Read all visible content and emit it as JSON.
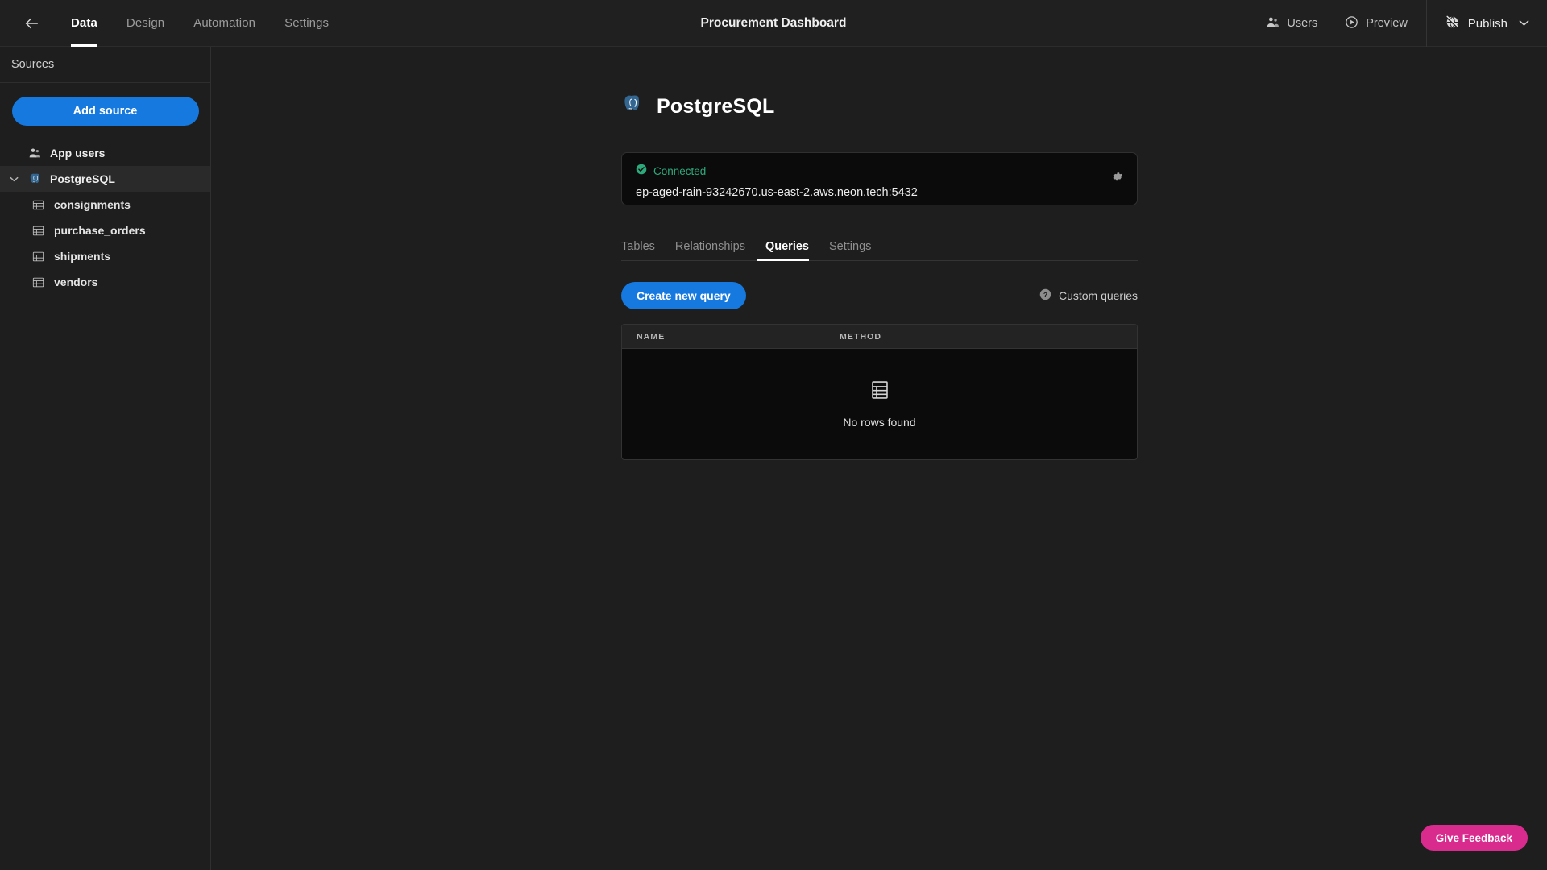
{
  "topbar": {
    "back_icon": "arrow-left-icon",
    "nav_tabs": [
      {
        "label": "Data",
        "active": true
      },
      {
        "label": "Design",
        "active": false
      },
      {
        "label": "Automation",
        "active": false
      },
      {
        "label": "Settings",
        "active": false
      }
    ],
    "app_title": "Procurement Dashboard",
    "users_label": "Users",
    "users_icon": "users-icon",
    "preview_label": "Preview",
    "preview_icon": "play-circle-icon",
    "publish_label": "Publish",
    "publish_icon": "globe-slash-icon",
    "publish_caret": "chevron-down-icon"
  },
  "sidebar": {
    "header": "Sources",
    "add_source_label": "Add source",
    "app_users": {
      "label": "App users",
      "icon": "users-icon"
    },
    "datasource": {
      "label": "PostgreSQL",
      "icon": "postgresql-icon",
      "caret": "chevron-down-icon",
      "expanded": true,
      "selected": true
    },
    "tables": [
      {
        "label": "consignments",
        "icon": "table-icon"
      },
      {
        "label": "purchase_orders",
        "icon": "table-icon"
      },
      {
        "label": "shipments",
        "icon": "table-icon"
      },
      {
        "label": "vendors",
        "icon": "table-icon"
      }
    ]
  },
  "main": {
    "db_title": "PostgreSQL",
    "db_icon": "postgresql-icon",
    "connection": {
      "status": "Connected",
      "status_icon": "check-circle-icon",
      "host": "ep-aged-rain-93242670.us-east-2.aws.neon.tech:5432",
      "settings_icon": "gear-icon"
    },
    "tabs": [
      {
        "label": "Tables",
        "active": false
      },
      {
        "label": "Relationships",
        "active": false
      },
      {
        "label": "Queries",
        "active": true
      },
      {
        "label": "Settings",
        "active": false
      }
    ],
    "create_query_label": "Create new query",
    "custom_queries_label": "Custom queries",
    "custom_queries_icon": "help-circle-icon",
    "query_table": {
      "columns": [
        "NAME",
        "METHOD"
      ],
      "rows": [],
      "empty_text": "No rows found",
      "empty_icon": "table-icon"
    }
  },
  "feedback": {
    "label": "Give Feedback"
  },
  "colors": {
    "accent_blue": "#1579df",
    "status_green": "#2ea97c",
    "feedback_pink": "#d92b8e",
    "bg": "#1e1e1e",
    "card_bg": "#0b0b0b"
  }
}
